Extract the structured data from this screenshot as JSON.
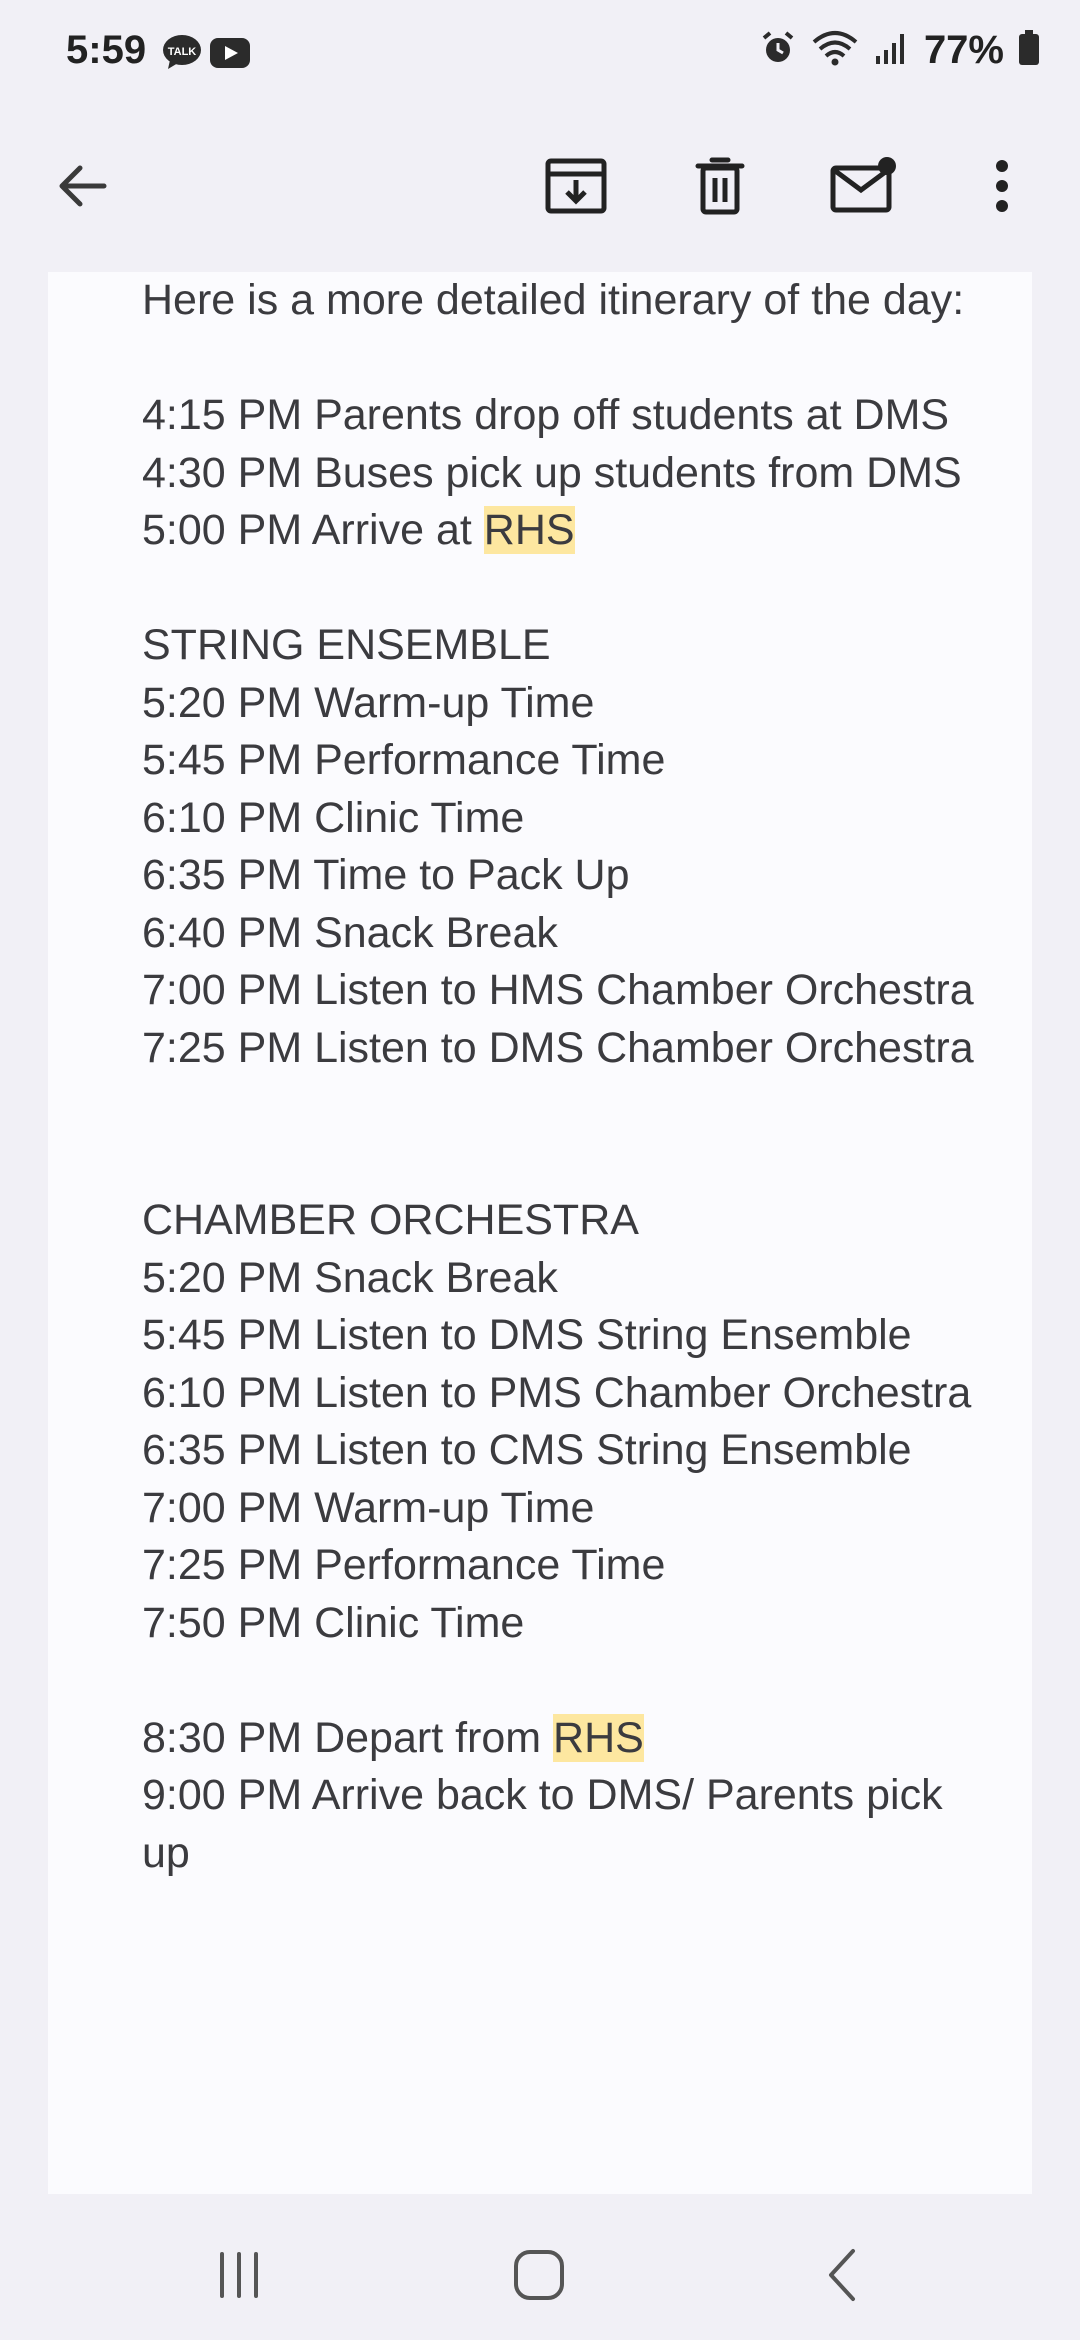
{
  "status_bar": {
    "time": "5:59",
    "battery": "77%",
    "icons": [
      "talk-icon",
      "youtube-icon",
      "alarm-icon",
      "wifi-icon",
      "signal-icon",
      "battery-icon"
    ]
  },
  "app_bar": {
    "icons": [
      "back-arrow-icon",
      "archive-icon",
      "delete-icon",
      "mark-unread-icon",
      "more-vert-icon"
    ]
  },
  "email": {
    "intro": "Here is a more detailed itinerary of the day:",
    "line_415": "4:15 PM Parents drop off students at DMS",
    "line_430": "4:30 PM Buses pick up students from DMS",
    "arrive_prefix": "5:00 PM Arrive at ",
    "arrive_highlight": "RHS",
    "string_ensemble": {
      "heading": "STRING ENSEMBLE",
      "items": [
        "5:20 PM Warm-up Time",
        "5:45 PM Performance Time",
        "6:10 PM Clinic Time",
        "6:35 PM Time to Pack Up",
        "6:40 PM Snack Break",
        "7:00 PM Listen to HMS Chamber Orchestra",
        "7:25 PM Listen to DMS Chamber Orchestra"
      ]
    },
    "chamber_orchestra": {
      "heading": "CHAMBER ORCHESTRA",
      "items": [
        "5:20 PM Snack Break",
        "5:45 PM Listen to DMS String Ensemble",
        "6:10 PM Listen to PMS Chamber Orchestra",
        "6:35 PM Listen to CMS String Ensemble",
        "7:00 PM Warm-up Time",
        "7:25 PM Performance Time",
        "7:50 PM Clinic Time"
      ]
    },
    "depart_prefix": "8:30 PM Depart from ",
    "depart_highlight": "RHS",
    "line_900": "9:00 PM Arrive back to DMS/ Parents pick up"
  },
  "nav_bar": {
    "icons": [
      "recent-apps-icon",
      "home-icon",
      "back-icon"
    ]
  }
}
